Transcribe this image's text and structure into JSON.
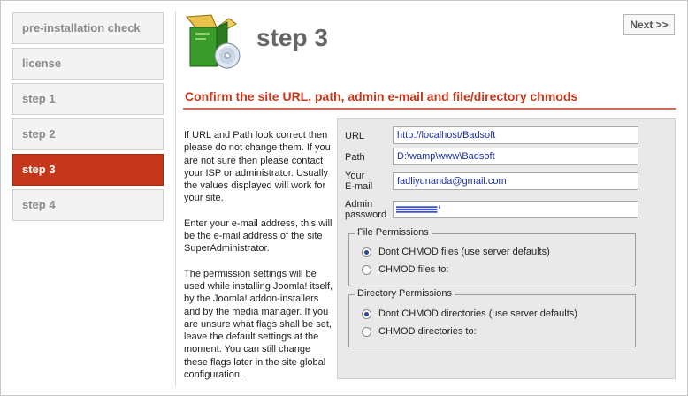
{
  "sidebar": {
    "items": [
      {
        "label": "pre-installation check",
        "active": false
      },
      {
        "label": "license",
        "active": false
      },
      {
        "label": "step 1",
        "active": false
      },
      {
        "label": "step 2",
        "active": false
      },
      {
        "label": "step 3",
        "active": true
      },
      {
        "label": "step 4",
        "active": false
      }
    ]
  },
  "header": {
    "title": "step 3",
    "next_label": "Next >>",
    "logo_icon": "software-box-cd-icon"
  },
  "subtitle": "Confirm the site URL, path, admin e-mail and file/directory chmods",
  "help": {
    "p1": "If URL and Path look correct then please do not change them. If you are not sure then please contact your ISP or administrator. Usually the values displayed will work for your site.",
    "p2": "Enter your e-mail address, this will be the e-mail address of the site SuperAdministrator.",
    "p3": "The permission settings will be used while installing Joomla! itself, by the Joomla! addon-installers and by the media manager. If you are unsure what flags shall be set, leave the default settings at the moment. You can still change these flags later in the site global configuration."
  },
  "form": {
    "url_label": "URL",
    "url_value": "http://localhost/Badsoft",
    "path_label": "Path",
    "path_value": "D:\\wamp\\www\\Badsoft",
    "email_label_1": "Your",
    "email_label_2": "E-mail",
    "email_value": "fadliyunanda@gmail.com",
    "password_label_1": "Admin",
    "password_label_2": "password",
    "file_permissions": {
      "legend": "File Permissions",
      "option_default": "Dont CHMOD files (use server defaults)",
      "option_custom": "CHMOD files to:",
      "selected": "default"
    },
    "dir_permissions": {
      "legend": "Directory Permissions",
      "option_default": "Dont CHMOD directories (use server defaults)",
      "option_custom": "CHMOD directories to:",
      "selected": "default"
    }
  },
  "colors": {
    "accent": "#c4371a",
    "panel_bg": "#e9e9e9",
    "input_text": "#1a2fa0"
  }
}
